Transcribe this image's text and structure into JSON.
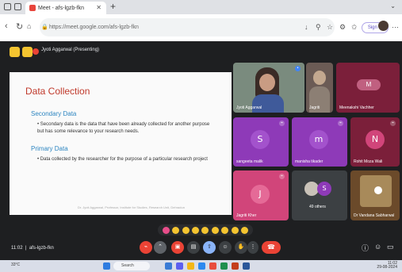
{
  "browser": {
    "tab_title": "Meet - afs-lgzb-fkn",
    "url": "https://meet.google.com/afs-lgzb-fkn",
    "sign_in_label": "Sign in"
  },
  "meet": {
    "presenting_label": "Jyoti Aggarwal (Presenting)",
    "meeting_time": "11:02",
    "meeting_code": "afs-lgzb-fkn"
  },
  "slide": {
    "title": "Data Collection",
    "section1_heading": "Secondary Data",
    "section1_bullet": "• Secondary data is the data that have been already collected for another purpose but has some relevance to your research needs.",
    "section2_heading": "Primary Data",
    "section2_bullet": "• Data collected by the researcher for the purpose of a particular research project",
    "footer": "Dr. Jyoti Aggarwal, Professor, Institute for Studies, Research Unit, Dehradun"
  },
  "participants": [
    {
      "name": "Jyoti Aggarwal",
      "initial": "",
      "color": "#7a8b7e"
    },
    {
      "name": "Jagriti",
      "initial": "",
      "color": "#6b5b55"
    },
    {
      "name": "Meenakshi Vachher",
      "initial": "M",
      "color": "#7b1f3a"
    },
    {
      "name": "sangeeta malik",
      "initial": "S",
      "color": "#8e3ab8"
    },
    {
      "name": "manisha tikader",
      "initial": "m",
      "color": "#8e3ab8"
    },
    {
      "name": "Rohit Moza Wali",
      "initial": "N",
      "color": "#7b1f3a"
    },
    {
      "name": "Jagriti Kher",
      "initial": "J",
      "color": "#d1457a"
    },
    {
      "name": "49 others",
      "initial": "S",
      "color": "#3c4043"
    },
    {
      "name": "Dr Vandana Sabharwal",
      "initial": "",
      "color": "#6b4a2a"
    }
  ],
  "taskbar": {
    "weather": "33°C",
    "search_placeholder": "Search",
    "time": "11:02",
    "date": "29-08-2024"
  }
}
